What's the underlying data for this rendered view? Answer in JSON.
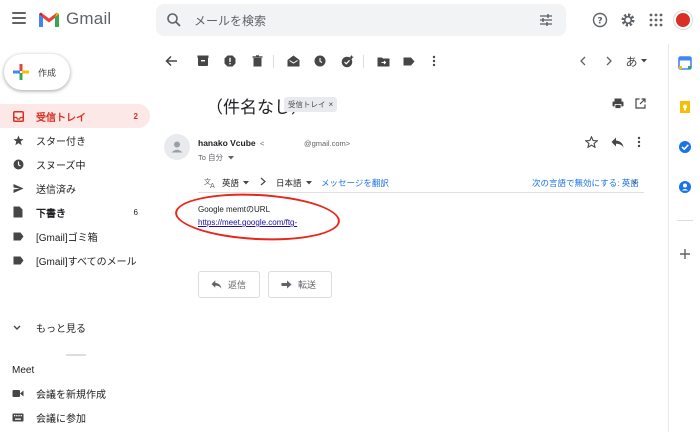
{
  "header": {
    "logo_text": "Gmail",
    "search_placeholder": "メールを検索",
    "avatar_color": "#d93025"
  },
  "sidebar": {
    "compose_label": "作成",
    "items": [
      {
        "label": "受信トレイ",
        "count": "2",
        "icon": "inbox-icon"
      },
      {
        "label": "スター付き",
        "count": "",
        "icon": "star-icon"
      },
      {
        "label": "スヌーズ中",
        "count": "",
        "icon": "clock-icon"
      },
      {
        "label": "送信済み",
        "count": "",
        "icon": "send-icon"
      },
      {
        "label": "下書き",
        "count": "6",
        "icon": "draft-icon"
      },
      {
        "label": "[Gmail]ゴミ箱",
        "count": "",
        "icon": "label-icon"
      },
      {
        "label": "[Gmail]すべてのメール",
        "count": "",
        "icon": "label-icon"
      }
    ],
    "more_label": "もっと見る",
    "meet_heading": "Meet",
    "meet_items": [
      {
        "label": "会議を新規作成",
        "icon": "video-icon"
      },
      {
        "label": "会議に参加",
        "icon": "keyboard-icon"
      }
    ]
  },
  "toolbar": {
    "input_tool_label": "あ"
  },
  "message": {
    "subject": "（件名なし）",
    "label_chip": "受信トレイ",
    "sender_name": "hanako Vcube",
    "sender_email_open": "<",
    "sender_email_domain": "@gmail.com>",
    "to_label": "To 自分",
    "translate": {
      "from_lang": "英語",
      "to_lang": "日本語",
      "translate_link": "メッセージを翻訳",
      "disable_link": "次の言語で無効にする: 英語"
    },
    "body_line1": "Google memtのURL",
    "body_link": "https://meet.google.com/ftg-"
  },
  "actions": {
    "reply_label": "返信",
    "forward_label": "転送"
  },
  "colors": {
    "accent_red": "#d93025",
    "link_blue": "#1a73e8",
    "highlight_oval": "#e8261a"
  }
}
